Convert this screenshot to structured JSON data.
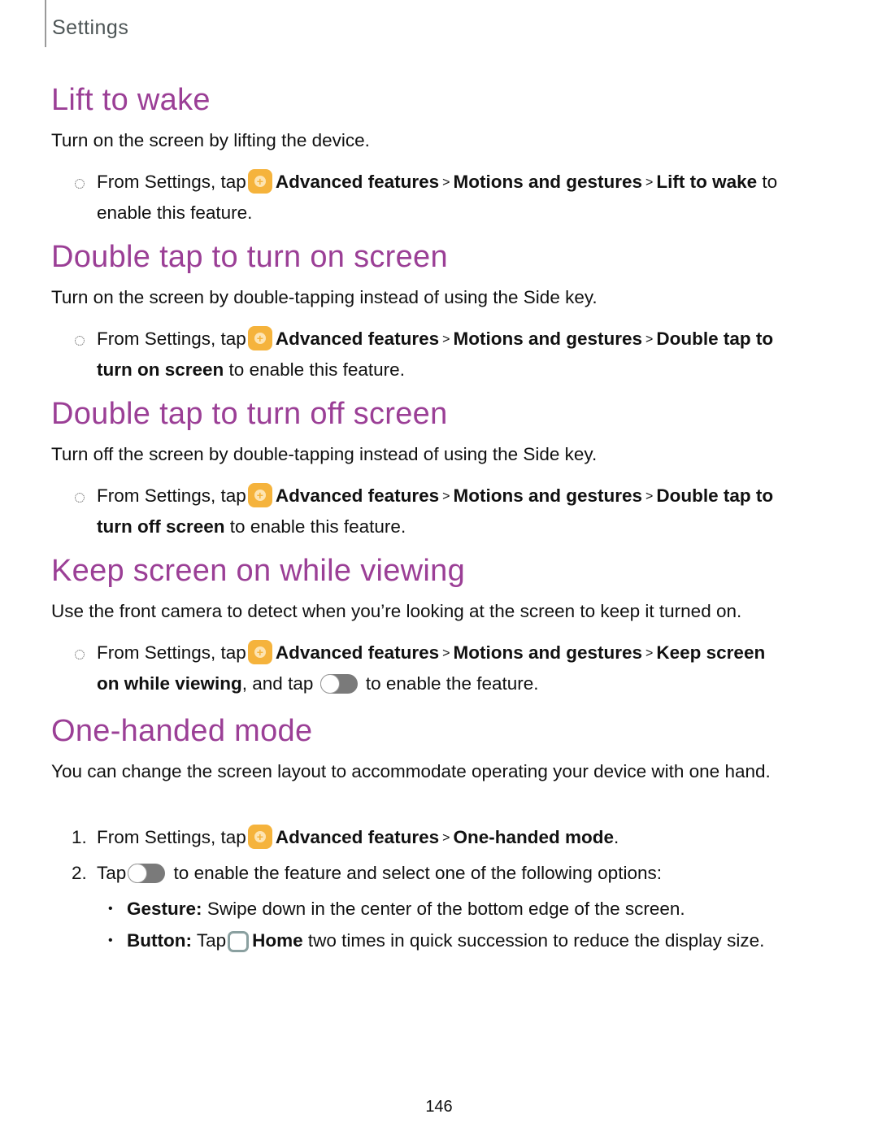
{
  "header": {
    "title": "Settings"
  },
  "common": {
    "from_settings": "From Settings, tap",
    "advanced_features": "Advanced features",
    "motions_and_gestures": "Motions and gestures",
    "separator": ">",
    "to_enable": "to enable this feature.",
    "icons": {
      "advanced_features": "advanced-features-gear-icon",
      "toggle": "toggle-switch-icon",
      "home": "home-button-icon"
    },
    "heading_color": "#9b3f96",
    "gear_color": "#f5b33c"
  },
  "sections": [
    {
      "title": "Lift to wake",
      "description": "Turn on the screen by lifting the device.",
      "target": "Lift to wake",
      "tail": "to",
      "tail2": "enable this feature."
    },
    {
      "title": "Double tap to turn on screen",
      "description": "Turn on the screen by double-tapping instead of using the Side key.",
      "target_line1": "Double tap to",
      "target_line2": "turn on screen",
      "tail": "to enable this feature."
    },
    {
      "title": "Double tap to turn off screen",
      "description": "Turn off the screen by double-tapping instead of using the Side key.",
      "target_line1": "Double tap to",
      "target_line2": "turn off screen",
      "tail": "to enable this feature."
    },
    {
      "title": "Keep screen on while viewing",
      "description": "Use the front camera to detect when you’re looking at the screen to keep it turned on.",
      "target_line1": "Keep screen",
      "target_line2": "on while viewing",
      "and_tap": ", and tap",
      "tail": "to enable the feature."
    },
    {
      "title": "One-handed mode",
      "description": "You can change the screen layout to accommodate operating your device with one hand.",
      "steps": [
        {
          "number": "1.",
          "target": "One-handed mode",
          "end": "."
        },
        {
          "number": "2.",
          "tap": "Tap",
          "text": "to enable the feature and select one of the following options:"
        }
      ],
      "options": [
        {
          "label": "Gesture",
          "text": "Swipe down in the center of the bottom edge of the screen."
        },
        {
          "label": "Button",
          "tap": "Tap",
          "home": "Home",
          "text": "two times in quick succession to reduce the display size."
        }
      ]
    }
  ],
  "page_number": "146"
}
